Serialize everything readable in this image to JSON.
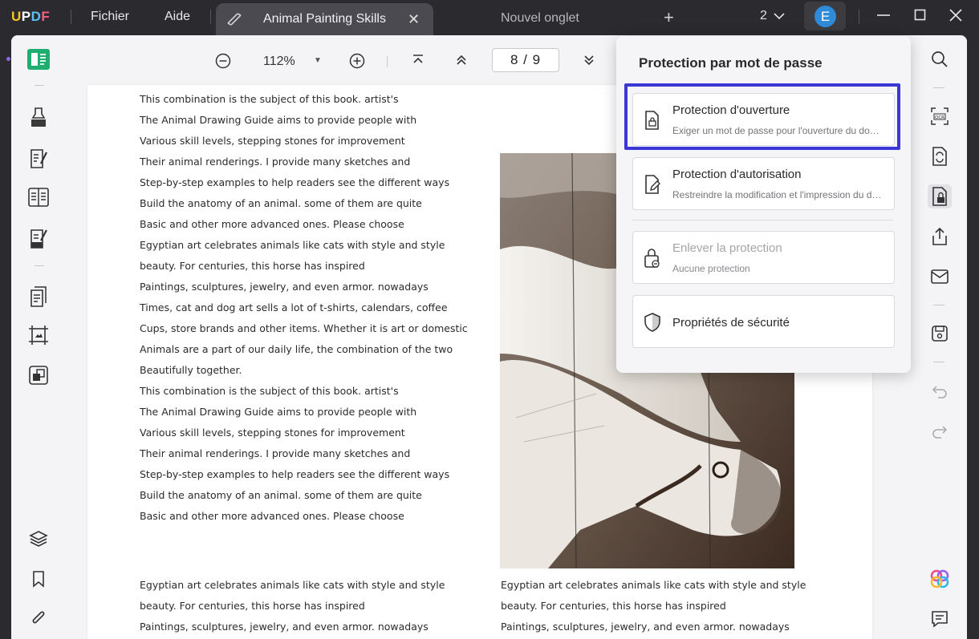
{
  "app": {
    "logo": "UPDF",
    "menu": [
      "Fichier",
      "Aide"
    ]
  },
  "tabs": {
    "active_title": "Animal Painting Skills",
    "new_tab_label": "Nouvel onglet",
    "count": "2"
  },
  "user": {
    "avatar_letter": "E"
  },
  "toolbar": {
    "zoom": "112%",
    "page_current": "8",
    "page_total": "9"
  },
  "panel": {
    "title": "Protection par mot de passe",
    "options": [
      {
        "title": "Protection d'ouverture",
        "desc": "Exiger un mot de passe pour l'ouverture du document",
        "icon": "doc-lock-icon"
      },
      {
        "title": "Protection d'autorisation",
        "desc": "Restreindre la modification et l'impression du document",
        "icon": "doc-edit-icon"
      },
      {
        "title": "Enlever la protection",
        "desc": "Aucune protection",
        "icon": "unlock-icon",
        "disabled": true
      },
      {
        "title": "Propriétés de sécurité",
        "icon": "shield-icon"
      }
    ],
    "highlight_color": "#3b36d6"
  },
  "document": {
    "column1": [
      "This combination is the subject of this book. artist's",
      "The Animal Drawing Guide aims to provide people with",
      "Various skill levels, stepping stones for improvement",
      "Their animal renderings. I provide many sketches and",
      "Step-by-step examples to help readers see the different ways",
      "Build the anatomy of an animal. some of them are quite",
      "Basic and other more advanced ones. Please choose",
      "Egyptian art celebrates animals like cats with style and style",
      "beauty. For centuries, this horse has inspired",
      "Paintings, sculptures, jewelry, and even armor. nowadays",
      "Times, cat and dog art sells a lot of t-shirts, calendars, coffee",
      "Cups, store brands and other items. Whether it is art or domestic",
      "Animals are a part of our daily life, the combination of the two",
      "Beautifully together.",
      "This combination is the subject of this book. artist's",
      "The Animal Drawing Guide aims to provide people with",
      "Various skill levels, stepping stones for improvement",
      "Their animal renderings. I provide many sketches and",
      "Step-by-step examples to help readers see the different ways",
      "Build the anatomy of an animal. some of them are quite",
      "Basic and other more advanced ones. Please choose"
    ],
    "bottom_left": [
      "Egyptian art celebrates animals like cats with style and style",
      "beauty. For centuries, this horse has inspired",
      "Paintings, sculptures, jewelry, and even armor. nowadays"
    ],
    "bottom_right": [
      "Egyptian art celebrates animals like cats with style and style",
      "beauty. For centuries, this horse has inspired",
      "Paintings, sculptures, jewelry, and even armor. nowadays"
    ]
  }
}
